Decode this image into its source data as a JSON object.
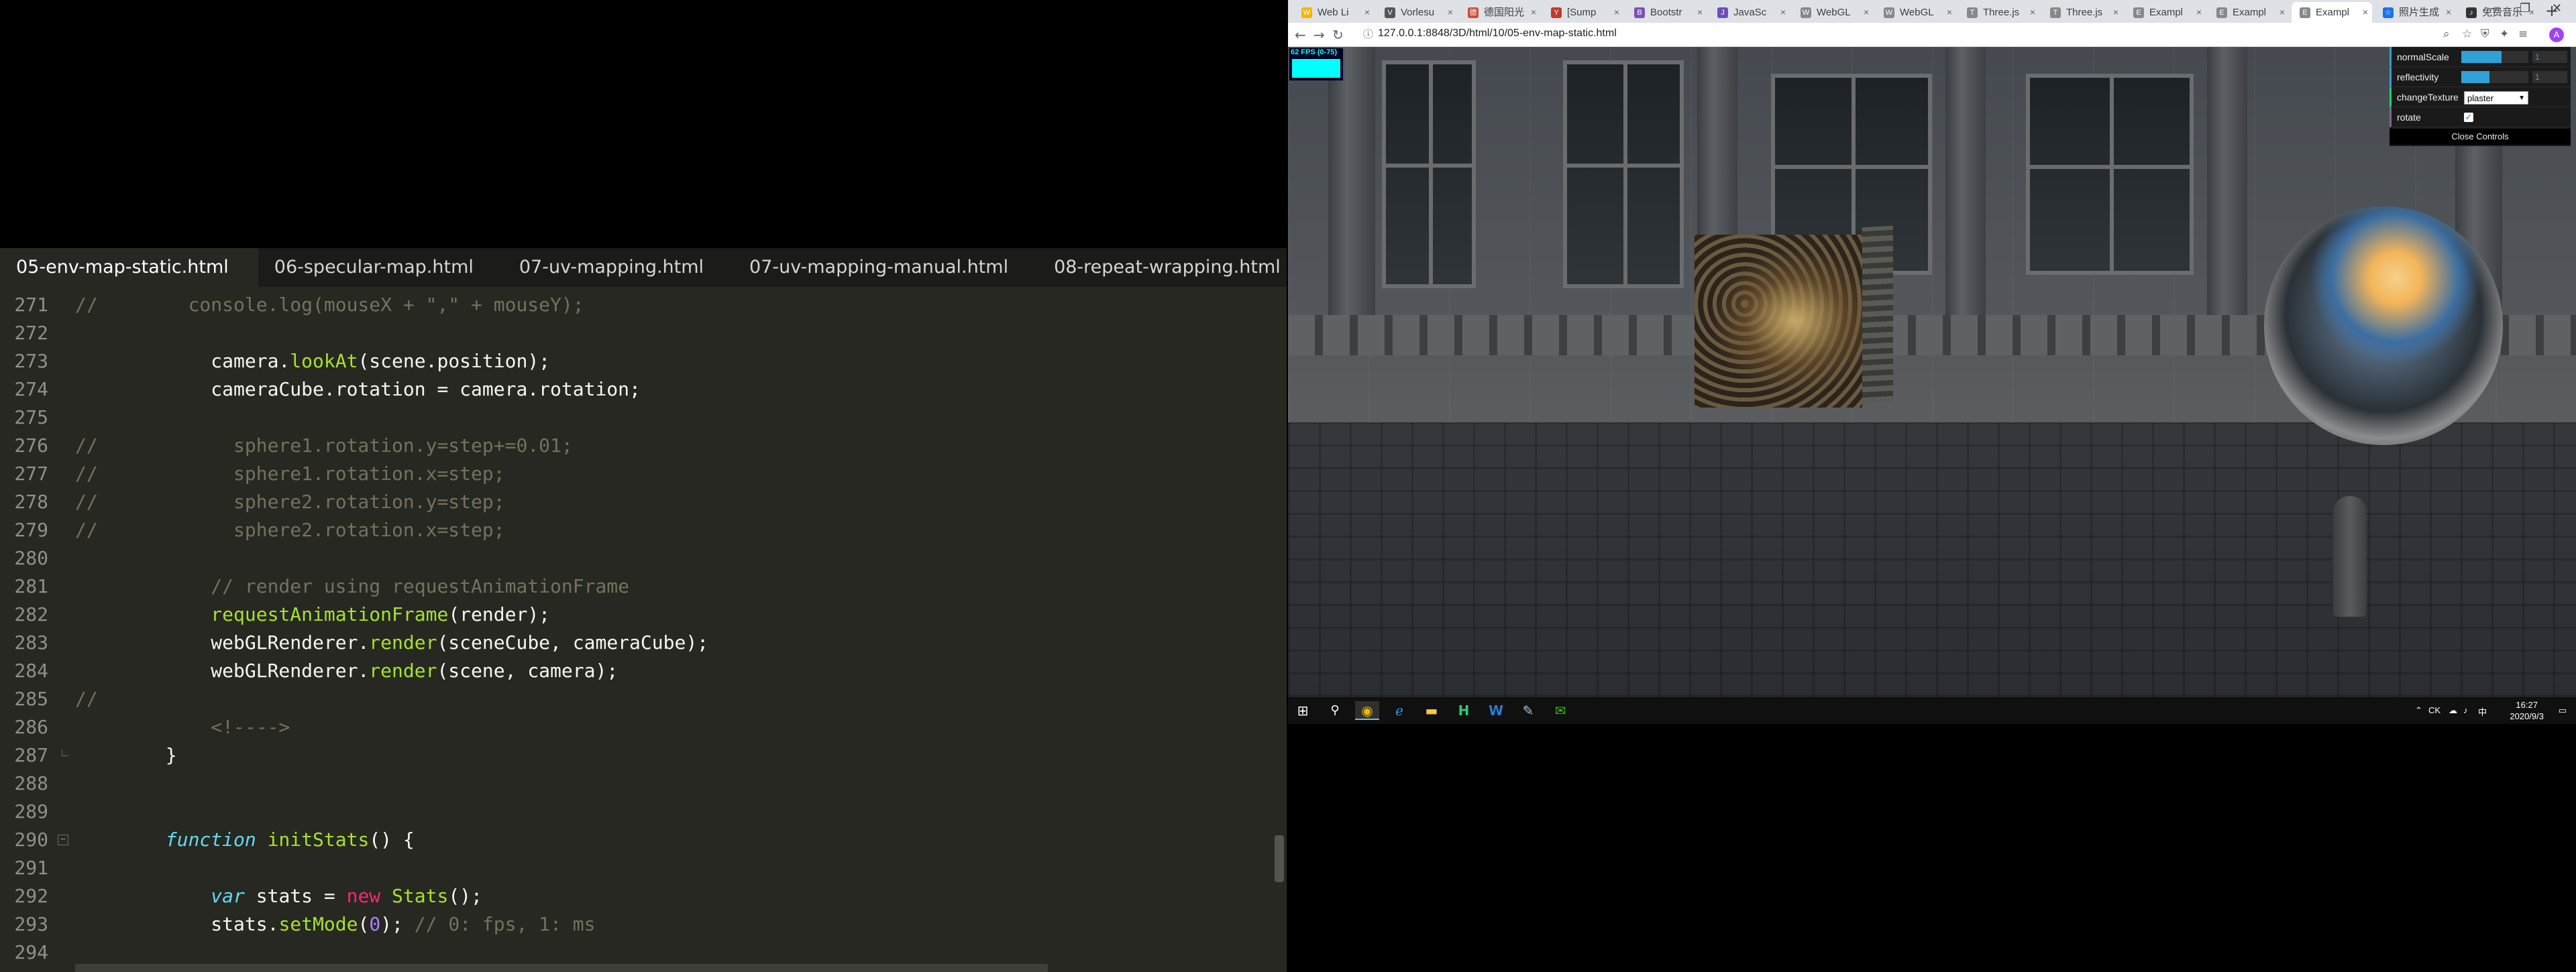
{
  "editor": {
    "tabs": [
      {
        "label": "05-env-map-static.html",
        "active": true
      },
      {
        "label": "06-specular-map.html",
        "active": false
      },
      {
        "label": "07-uv-mapping.html",
        "active": false
      },
      {
        "label": "07-uv-mapping-manual.html",
        "active": false
      },
      {
        "label": "08-repeat-wrapping.html",
        "active": false
      }
    ],
    "lines": [
      {
        "n": "271",
        "segs": [
          {
            "t": "//        console.log(mouseX + \",\" + mouseY);",
            "c": "com"
          }
        ]
      },
      {
        "n": "272",
        "segs": []
      },
      {
        "n": "273",
        "segs": [
          {
            "t": "            camera.",
            "c": "pl"
          },
          {
            "t": "lookAt",
            "c": "fn"
          },
          {
            "t": "(scene.position);",
            "c": "pl"
          }
        ]
      },
      {
        "n": "274",
        "segs": [
          {
            "t": "            cameraCube.rotation = camera.rotation;",
            "c": "pl"
          }
        ]
      },
      {
        "n": "275",
        "segs": []
      },
      {
        "n": "276",
        "segs": [
          {
            "t": "//            sphere1.rotation.y=step+=0.01;",
            "c": "com"
          }
        ]
      },
      {
        "n": "277",
        "segs": [
          {
            "t": "//            sphere1.rotation.x=step;",
            "c": "com"
          }
        ]
      },
      {
        "n": "278",
        "segs": [
          {
            "t": "//            sphere2.rotation.y=step;",
            "c": "com"
          }
        ]
      },
      {
        "n": "279",
        "segs": [
          {
            "t": "//            sphere2.rotation.x=step;",
            "c": "com"
          }
        ]
      },
      {
        "n": "280",
        "segs": []
      },
      {
        "n": "281",
        "segs": [
          {
            "t": "            // render using requestAnimationFrame",
            "c": "com"
          }
        ]
      },
      {
        "n": "282",
        "segs": [
          {
            "t": "            ",
            "c": "pl"
          },
          {
            "t": "requestAnimationFrame",
            "c": "fn"
          },
          {
            "t": "(render);",
            "c": "pl"
          }
        ]
      },
      {
        "n": "283",
        "segs": [
          {
            "t": "            webGLRenderer.",
            "c": "pl"
          },
          {
            "t": "render",
            "c": "fn"
          },
          {
            "t": "(sceneCube, cameraCube);",
            "c": "pl"
          }
        ]
      },
      {
        "n": "284",
        "segs": [
          {
            "t": "            webGLRenderer.",
            "c": "pl"
          },
          {
            "t": "render",
            "c": "fn"
          },
          {
            "t": "(scene, camera);",
            "c": "pl"
          }
        ]
      },
      {
        "n": "285",
        "segs": [
          {
            "t": "//",
            "c": "com"
          }
        ]
      },
      {
        "n": "286",
        "segs": [
          {
            "t": "            <!---->",
            "c": "com"
          }
        ]
      },
      {
        "n": "287",
        "segs": [
          {
            "t": "        }",
            "c": "pl"
          }
        ],
        "foldEnd": true
      },
      {
        "n": "288",
        "segs": []
      },
      {
        "n": "289",
        "segs": []
      },
      {
        "n": "290",
        "segs": [
          {
            "t": "        ",
            "c": "pl"
          },
          {
            "t": "function",
            "c": "kw"
          },
          {
            "t": " ",
            "c": "pl"
          },
          {
            "t": "initStats",
            "c": "fn"
          },
          {
            "t": "() {",
            "c": "pl"
          }
        ],
        "fold": true
      },
      {
        "n": "291",
        "segs": []
      },
      {
        "n": "292",
        "segs": [
          {
            "t": "            ",
            "c": "pl"
          },
          {
            "t": "var",
            "c": "kw"
          },
          {
            "t": " stats = ",
            "c": "pl"
          },
          {
            "t": "new",
            "c": "red"
          },
          {
            "t": " ",
            "c": "pl"
          },
          {
            "t": "Stats",
            "c": "fn"
          },
          {
            "t": "();",
            "c": "pl"
          }
        ]
      },
      {
        "n": "293",
        "segs": [
          {
            "t": "            stats.",
            "c": "pl"
          },
          {
            "t": "setMode",
            "c": "fn"
          },
          {
            "t": "(",
            "c": "pl"
          },
          {
            "t": "0",
            "c": "num"
          },
          {
            "t": "); ",
            "c": "pl"
          },
          {
            "t": "// 0: fps, 1: ms",
            "c": "com"
          }
        ]
      },
      {
        "n": "294",
        "segs": []
      }
    ]
  },
  "browser": {
    "tabs": [
      {
        "label": "Web Li",
        "fav": "W",
        "color": "#f4b400"
      },
      {
        "label": "Vorlesu",
        "fav": "V",
        "color": "#555555"
      },
      {
        "label": "德国阳光",
        "fav": "德",
        "color": "#d14836"
      },
      {
        "label": "[Sump",
        "fav": "Y",
        "color": "#c0392b"
      },
      {
        "label": "Bootstr",
        "fav": "B",
        "color": "#7952b3"
      },
      {
        "label": "JavaSc",
        "fav": "J",
        "color": "#6b4fbb"
      },
      {
        "label": "WebGL",
        "fav": "W",
        "color": "#888888"
      },
      {
        "label": "WebGL",
        "fav": "W",
        "color": "#888888"
      },
      {
        "label": "Three.js",
        "fav": "T",
        "color": "#888888"
      },
      {
        "label": "Three.js",
        "fav": "T",
        "color": "#888888"
      },
      {
        "label": "Exampl",
        "fav": "E",
        "color": "#888888"
      },
      {
        "label": "Exampl",
        "fav": "E",
        "color": "#888888"
      },
      {
        "label": "Exampl",
        "fav": "E",
        "color": "#888888",
        "active": true
      },
      {
        "label": "照片生成",
        "fav": "☆",
        "color": "#1a73e8"
      },
      {
        "label": "免费音乐",
        "fav": "♪",
        "color": "#333333"
      }
    ],
    "url": "127.0.0.1:8848/3D/html/10/05-env-map-static.html",
    "stats_label": "62 FPS (0-75)",
    "avatar_letter": "A"
  },
  "gui": {
    "controls": [
      {
        "type": "num",
        "name": "normalScale",
        "value": "1",
        "fraction": 0.6
      },
      {
        "type": "num",
        "name": "reflectivity",
        "value": "1",
        "fraction": 0.42
      },
      {
        "type": "sel",
        "name": "changeTexture",
        "value": "plaster"
      },
      {
        "type": "chk",
        "name": "rotate",
        "checked": true
      }
    ],
    "close_label": "Close Controls"
  },
  "taskbar": {
    "tray_ime": "CK",
    "time": "16:27",
    "date": "2020/9/3"
  }
}
